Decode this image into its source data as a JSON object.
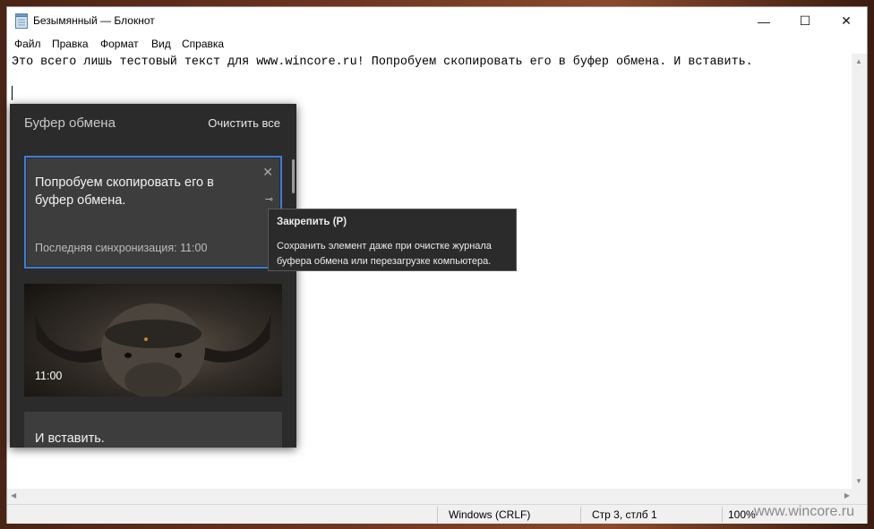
{
  "window": {
    "title": "Безымянный — Блокнот",
    "minimize_glyph": "—",
    "maximize_glyph": "☐",
    "close_glyph": "✕"
  },
  "menu": {
    "items": [
      {
        "label": "Файл"
      },
      {
        "label": "Правка"
      },
      {
        "label": "Формат"
      },
      {
        "label": "Вид"
      },
      {
        "label": "Справка"
      }
    ]
  },
  "editor": {
    "line1": "Это всего лишь тестовый текст для www.wincore.ru! Попробуем скопировать его в буфер обмена. И вставить."
  },
  "statusbar": {
    "encoding": "Windows (CRLF)",
    "position": "Стр 3, стлб 1",
    "zoom": "100%"
  },
  "watermark": "www.wincore.ru",
  "clipboard": {
    "title": "Буфер обмена",
    "clear_all": "Очистить все",
    "items": [
      {
        "text": "Попробуем скопировать его в буфер обмена.",
        "sync": "Последняя синхронизация: 11:00",
        "close_icon": "✕",
        "pin_icon": "⊸"
      },
      {
        "time": "11:00",
        "icon": "buffalo-image"
      },
      {
        "text": "И вставить."
      }
    ]
  },
  "tooltip": {
    "title": "Закрепить (P)",
    "body": "Сохранить элемент даже при очистке журнала буфера обмена или перезагрузке компьютера."
  },
  "colors": {
    "accent": "#3a7fd5",
    "panel_bg": "#2b2b2b",
    "item_bg": "#3d3d3d"
  }
}
